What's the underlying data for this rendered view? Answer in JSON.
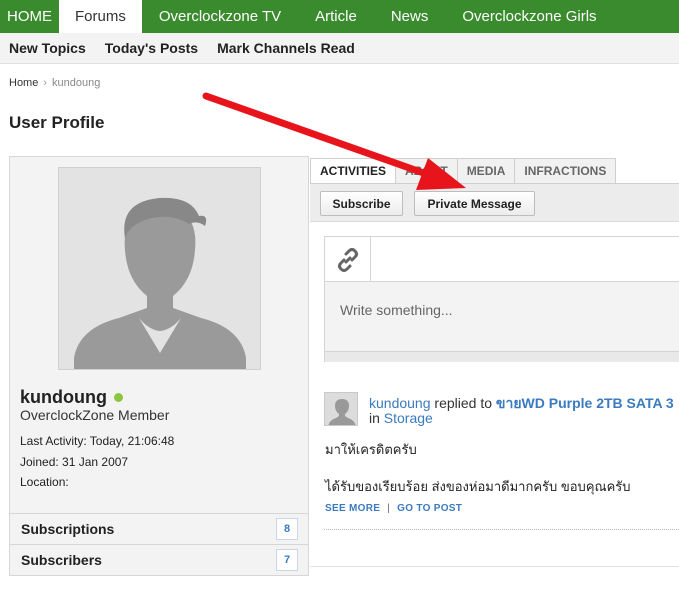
{
  "top_nav": [
    "HOME",
    "Forums",
    "Overclockzone TV",
    "Article",
    "News",
    "Overclockzone Girls"
  ],
  "sub_nav": [
    "New Topics",
    "Today's Posts",
    "Mark Channels Read"
  ],
  "breadcrumb": {
    "home": "Home",
    "current": "kundoung"
  },
  "page_title": "User Profile",
  "profile": {
    "username": "kundoung",
    "user_title": "OverclockZone Member",
    "last_activity": "Last Activity: Today, 21:06:48",
    "joined": "Joined: 31 Jan 2007",
    "location": "Location:",
    "online": true
  },
  "left_rows": [
    {
      "label": "Subscriptions",
      "count": "8"
    },
    {
      "label": "Subscribers",
      "count": "7"
    }
  ],
  "tabs": [
    "ACTIVITIES",
    "ABOUT",
    "MEDIA",
    "INFRACTIONS"
  ],
  "buttons": {
    "subscribe": "Subscribe",
    "private_message": "Private Message"
  },
  "composer": {
    "placeholder": "Write something..."
  },
  "activity": {
    "user": "kundoung",
    "action": "replied to",
    "thread_title": "ขายWD Purple 2TB SATA 3",
    "in_label": "in",
    "forum": "Storage",
    "line1": "มาให้เครดิตครับ",
    "line2": "ได้รับของเรียบร้อย ส่งของห่อมาดีมากครับ ขอบคุณครับ",
    "see_more": "SEE MORE",
    "separator": "|",
    "go_to_post": "GO TO POST"
  },
  "colors": {
    "nav_green": "#3a8a2e",
    "link_blue": "#3a7bbf",
    "arrow_red": "#e8141c",
    "online_green": "#8cc63f"
  },
  "annotation": "red arrow pointing to Private Message button"
}
